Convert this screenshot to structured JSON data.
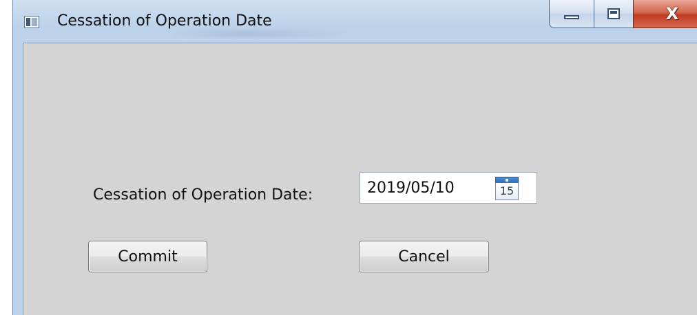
{
  "window": {
    "title": "Cessation of Operation Date",
    "controls": {
      "minimize_icon": "minimize-icon",
      "maximize_icon": "maximize-icon",
      "close_icon": "close-icon",
      "close_glyph": "X"
    }
  },
  "form": {
    "date_label": "Cessation of Operation Date:",
    "date_value": "2019/05/10",
    "calendar_icon": "calendar-icon",
    "calendar_day": "15",
    "commit_label": "Commit",
    "cancel_label": "Cancel"
  },
  "colors": {
    "client_background": "#d4d4d4",
    "close_button": "#c03a22",
    "calendar_header": "#2e6cb8"
  }
}
